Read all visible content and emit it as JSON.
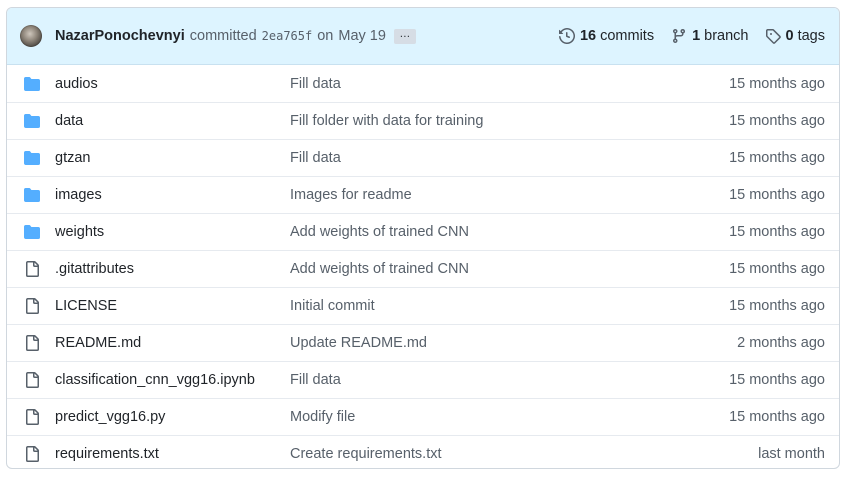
{
  "colors": {
    "header_bg": "#ddf4ff",
    "folder_icon": "#54aeff",
    "file_icon": "#57606a",
    "border": "#d0d7de"
  },
  "commit": {
    "author": "NazarPonochevnyi",
    "committed_text": "committed",
    "sha": "2ea765f",
    "on_text": "on",
    "date": "May 19",
    "ellipsis": "…"
  },
  "stats": {
    "commits_count": "16",
    "commits_label": "commits",
    "branch_count": "1",
    "branch_label": "branch",
    "tags_count": "0",
    "tags_label": "tags"
  },
  "files": [
    {
      "type": "folder",
      "icon": "folder-icon",
      "name": "audios",
      "message": "Fill data",
      "age": "15 months ago"
    },
    {
      "type": "folder",
      "icon": "folder-icon",
      "name": "data",
      "message": "Fill folder with data for training",
      "age": "15 months ago"
    },
    {
      "type": "folder",
      "icon": "folder-icon",
      "name": "gtzan",
      "message": "Fill data",
      "age": "15 months ago"
    },
    {
      "type": "folder",
      "icon": "folder-icon",
      "name": "images",
      "message": "Images for readme",
      "age": "15 months ago"
    },
    {
      "type": "folder",
      "icon": "folder-icon",
      "name": "weights",
      "message": "Add weights of trained CNN",
      "age": "15 months ago"
    },
    {
      "type": "file",
      "icon": "file-icon",
      "name": ".gitattributes",
      "message": "Add weights of trained CNN",
      "age": "15 months ago"
    },
    {
      "type": "file",
      "icon": "file-icon",
      "name": "LICENSE",
      "message": "Initial commit",
      "age": "15 months ago"
    },
    {
      "type": "file",
      "icon": "file-icon",
      "name": "README.md",
      "message": "Update README.md",
      "age": "2 months ago"
    },
    {
      "type": "file",
      "icon": "file-icon",
      "name": "classification_cnn_vgg16.ipynb",
      "message": "Fill data",
      "age": "15 months ago"
    },
    {
      "type": "file",
      "icon": "file-icon",
      "name": "predict_vgg16.py",
      "message": "Modify file",
      "age": "15 months ago"
    },
    {
      "type": "file",
      "icon": "file-icon",
      "name": "requirements.txt",
      "message": "Create requirements.txt",
      "age": "last month"
    }
  ]
}
